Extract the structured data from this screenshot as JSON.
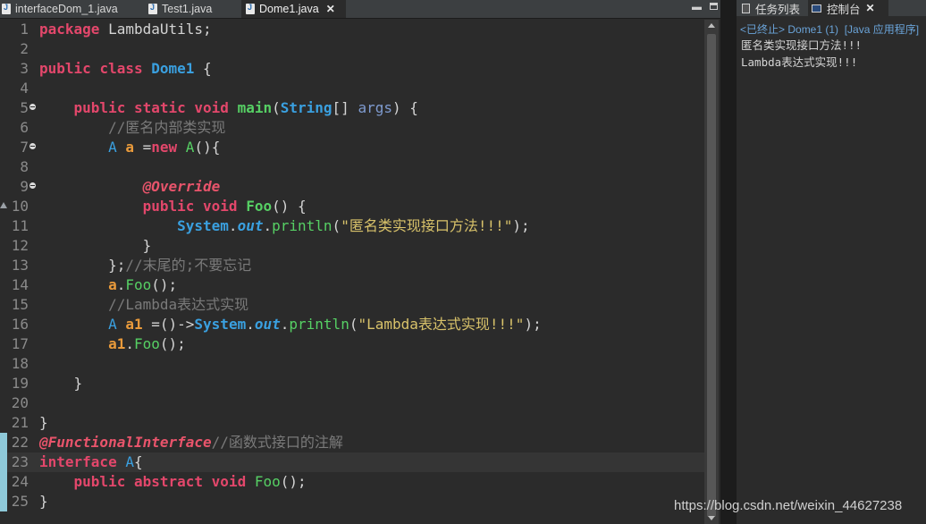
{
  "editor": {
    "tabs": [
      {
        "label": "interfaceDom_1.java",
        "active": false
      },
      {
        "label": "Test1.java",
        "active": false
      },
      {
        "label": "Dome1.java",
        "active": true,
        "close": "✕"
      }
    ],
    "minimize_glyph": "▬",
    "code_lines": [
      {
        "n": "1",
        "tokens": [
          [
            "kw",
            "package"
          ],
          [
            "pln",
            " LambdaUtils;"
          ]
        ]
      },
      {
        "n": "2",
        "tokens": []
      },
      {
        "n": "3",
        "tokens": [
          [
            "kw",
            "public"
          ],
          [
            "pln",
            " "
          ],
          [
            "kw",
            "class"
          ],
          [
            "pln",
            " "
          ],
          [
            "cls",
            "Dome1"
          ],
          [
            "pln",
            " {"
          ]
        ]
      },
      {
        "n": "4",
        "tokens": []
      },
      {
        "n": "5",
        "fold": true,
        "tokens": [
          [
            "pln",
            "    "
          ],
          [
            "kw",
            "public"
          ],
          [
            "pln",
            " "
          ],
          [
            "kw",
            "static"
          ],
          [
            "pln",
            " "
          ],
          [
            "kw",
            "void"
          ],
          [
            "pln",
            " "
          ],
          [
            "mthb",
            "main"
          ],
          [
            "pln",
            "("
          ],
          [
            "cls",
            "String"
          ],
          [
            "pln",
            "[] "
          ],
          [
            "prm",
            "args"
          ],
          [
            "pln",
            ") {"
          ]
        ]
      },
      {
        "n": "6",
        "tokens": [
          [
            "pln",
            "        "
          ],
          [
            "cmt",
            "//匿名内部类实现"
          ]
        ]
      },
      {
        "n": "7",
        "fold": true,
        "tokens": [
          [
            "pln",
            "        "
          ],
          [
            "typ",
            "A"
          ],
          [
            "pln",
            " "
          ],
          [
            "var",
            "a"
          ],
          [
            "pln",
            " ="
          ],
          [
            "kw",
            "new"
          ],
          [
            "pln",
            " "
          ],
          [
            "mth",
            "A"
          ],
          [
            "pln",
            "(){"
          ]
        ]
      },
      {
        "n": "8",
        "tokens": []
      },
      {
        "n": "9",
        "fold": true,
        "tokens": [
          [
            "pln",
            "            "
          ],
          [
            "ann",
            "@Override"
          ]
        ]
      },
      {
        "n": "10",
        "override": true,
        "tokens": [
          [
            "pln",
            "            "
          ],
          [
            "kw",
            "public"
          ],
          [
            "pln",
            " "
          ],
          [
            "kw",
            "void"
          ],
          [
            "pln",
            " "
          ],
          [
            "mthb",
            "Foo"
          ],
          [
            "pln",
            "() {"
          ]
        ]
      },
      {
        "n": "11",
        "tokens": [
          [
            "pln",
            "                "
          ],
          [
            "cls",
            "System"
          ],
          [
            "pln",
            "."
          ],
          [
            "fld",
            "out"
          ],
          [
            "pln",
            "."
          ],
          [
            "mth",
            "println"
          ],
          [
            "pln",
            "("
          ],
          [
            "str",
            "\"匿名类实现接口方法!!!\""
          ],
          [
            "pln",
            ");"
          ]
        ]
      },
      {
        "n": "12",
        "tokens": [
          [
            "pln",
            "            }"
          ]
        ]
      },
      {
        "n": "13",
        "tokens": [
          [
            "pln",
            "        };"
          ],
          [
            "cmt",
            "//末尾的;不要忘记"
          ]
        ]
      },
      {
        "n": "14",
        "tokens": [
          [
            "pln",
            "        "
          ],
          [
            "var",
            "a"
          ],
          [
            "pln",
            "."
          ],
          [
            "mth",
            "Foo"
          ],
          [
            "pln",
            "();"
          ]
        ]
      },
      {
        "n": "15",
        "tokens": [
          [
            "pln",
            "        "
          ],
          [
            "cmt",
            "//Lambda表达式实现"
          ]
        ]
      },
      {
        "n": "16",
        "tokens": [
          [
            "pln",
            "        "
          ],
          [
            "typ",
            "A"
          ],
          [
            "pln",
            " "
          ],
          [
            "var",
            "a1"
          ],
          [
            "pln",
            " =()->"
          ],
          [
            "cls",
            "System"
          ],
          [
            "pln",
            "."
          ],
          [
            "fld",
            "out"
          ],
          [
            "pln",
            "."
          ],
          [
            "mth",
            "println"
          ],
          [
            "pln",
            "("
          ],
          [
            "str",
            "\"Lambda表达式实现!!!\""
          ],
          [
            "pln",
            ");"
          ]
        ]
      },
      {
        "n": "17",
        "tokens": [
          [
            "pln",
            "        "
          ],
          [
            "var",
            "a1"
          ],
          [
            "pln",
            "."
          ],
          [
            "mth",
            "Foo"
          ],
          [
            "pln",
            "();"
          ]
        ]
      },
      {
        "n": "18",
        "tokens": []
      },
      {
        "n": "19",
        "tokens": [
          [
            "pln",
            "    }"
          ]
        ]
      },
      {
        "n": "20",
        "tokens": []
      },
      {
        "n": "21",
        "tokens": [
          [
            "pln",
            "}"
          ]
        ]
      },
      {
        "n": "22",
        "mark": true,
        "tokens": [
          [
            "ann",
            "@FunctionalInterface"
          ],
          [
            "cmt",
            "//函数式接口的注解"
          ]
        ]
      },
      {
        "n": "23",
        "mark": true,
        "current": true,
        "tokens": [
          [
            "kw",
            "interface"
          ],
          [
            "pln",
            " "
          ],
          [
            "typ",
            "A"
          ],
          [
            "pln",
            "{"
          ]
        ]
      },
      {
        "n": "24",
        "mark": true,
        "tokens": [
          [
            "pln",
            "    "
          ],
          [
            "kw",
            "public"
          ],
          [
            "pln",
            " "
          ],
          [
            "kw",
            "abstract"
          ],
          [
            "pln",
            " "
          ],
          [
            "kw",
            "void"
          ],
          [
            "pln",
            " "
          ],
          [
            "mth",
            "Foo"
          ],
          [
            "pln",
            "();"
          ]
        ]
      },
      {
        "n": "25",
        "mark": true,
        "tokens": [
          [
            "pln",
            "}"
          ]
        ]
      }
    ]
  },
  "console": {
    "tabs": [
      {
        "label": "任务列表",
        "icon": "tasks-icon"
      },
      {
        "label": "控制台",
        "icon": "console-icon",
        "close": "✕"
      }
    ],
    "status": "<已终止> Dome1 (1)  [Java 应用程序]",
    "output": [
      "匿名类实现接口方法!!!",
      "Lambda表达式实现!!!"
    ]
  },
  "watermark": "https://blog.csdn.net/weixin_44627238"
}
